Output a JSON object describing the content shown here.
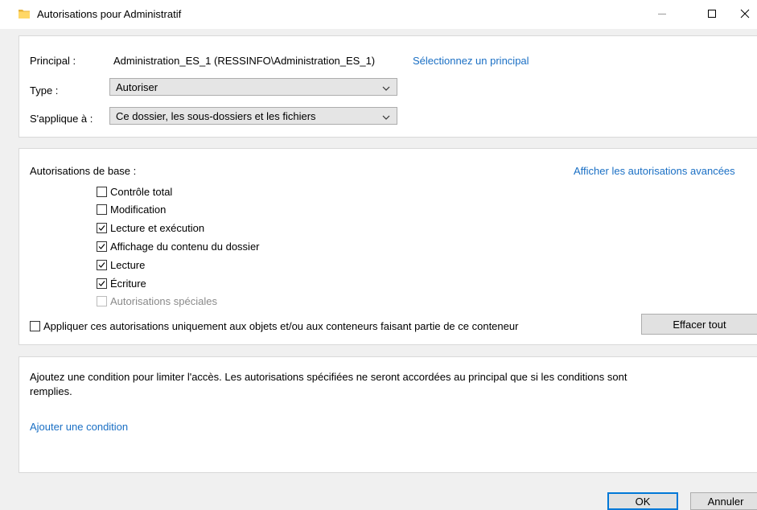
{
  "window": {
    "title": "Autorisations pour Administratif",
    "icons": {
      "folder": "folder-icon",
      "minimize": "minimize-icon",
      "maximize": "maximize-icon",
      "close": "close-icon"
    }
  },
  "principal": {
    "label": "Principal :",
    "value": "Administration_ES_1 (RESSINFO\\Administration_ES_1)",
    "select_link": "Sélectionnez un principal"
  },
  "type": {
    "label": "Type :",
    "selected": "Autoriser"
  },
  "applies_to": {
    "label": "S'applique à :",
    "selected": "Ce dossier, les sous-dossiers et les fichiers"
  },
  "basic_permissions": {
    "title": "Autorisations de base :",
    "advanced_link": "Afficher les autorisations avancées",
    "items": [
      {
        "label": "Contrôle total",
        "checked": false,
        "disabled": false
      },
      {
        "label": "Modification",
        "checked": false,
        "disabled": false
      },
      {
        "label": "Lecture et exécution",
        "checked": true,
        "disabled": false
      },
      {
        "label": "Affichage du contenu du dossier",
        "checked": true,
        "disabled": false
      },
      {
        "label": "Lecture",
        "checked": true,
        "disabled": false
      },
      {
        "label": "Écriture",
        "checked": true,
        "disabled": false
      },
      {
        "label": "Autorisations spéciales",
        "checked": false,
        "disabled": true
      }
    ],
    "apply_only_label": "Appliquer ces autorisations uniquement aux objets et/ou aux conteneurs faisant partie de ce conteneur",
    "apply_only_checked": false,
    "clear_all_label": "Effacer tout"
  },
  "condition": {
    "description_line1": "Ajoutez une condition pour limiter l'accès. Les autorisations spécifiées ne seront accordées au principal que si les conditions sont",
    "description_line2": "remplies.",
    "add_link": "Ajouter une condition"
  },
  "footer": {
    "ok_label": "OK",
    "cancel_label": "Annuler"
  },
  "colors": {
    "link": "#1a6fc4",
    "panel_bg": "#ffffff",
    "dialog_bg": "#f0f0f0",
    "accent": "#0078d7"
  }
}
